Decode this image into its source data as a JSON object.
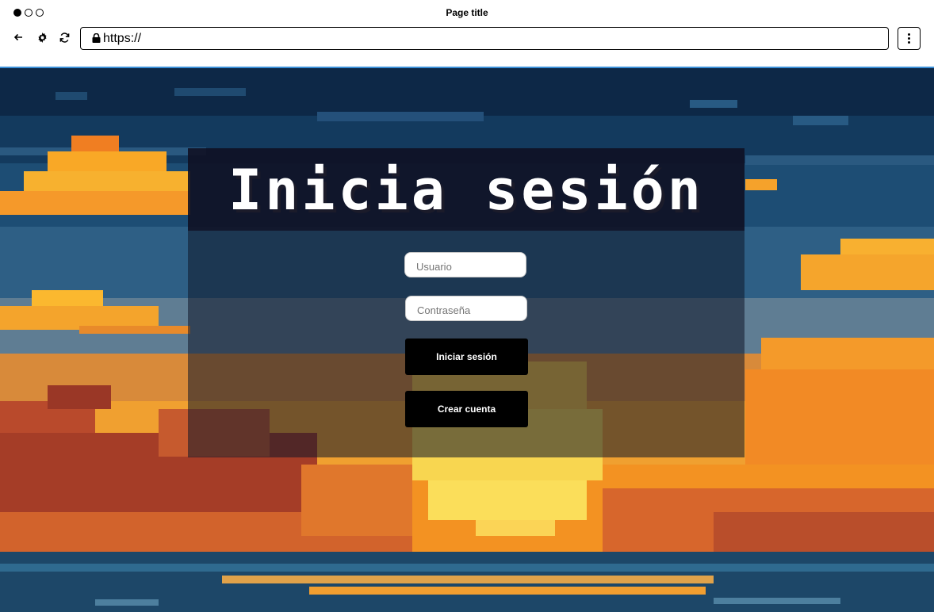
{
  "browser": {
    "page_title": "Page title",
    "url": "https://",
    "icons": [
      "back-arrow-icon",
      "gear-icon",
      "reload-icon",
      "lock-icon",
      "kebab-menu-icon"
    ]
  },
  "login": {
    "heading": "Inicia sesión",
    "username_placeholder": "Usuario",
    "password_placeholder": "Contraseña",
    "login_button": "Iniciar sesión",
    "create_account_button": "Crear cuenta"
  },
  "colors": {
    "accent_border": "#3a8fd8",
    "button_bg": "#000000",
    "sky_dark": "#0f2a48",
    "sun": "#f8d650",
    "cloud_orange": "#f59a24"
  }
}
